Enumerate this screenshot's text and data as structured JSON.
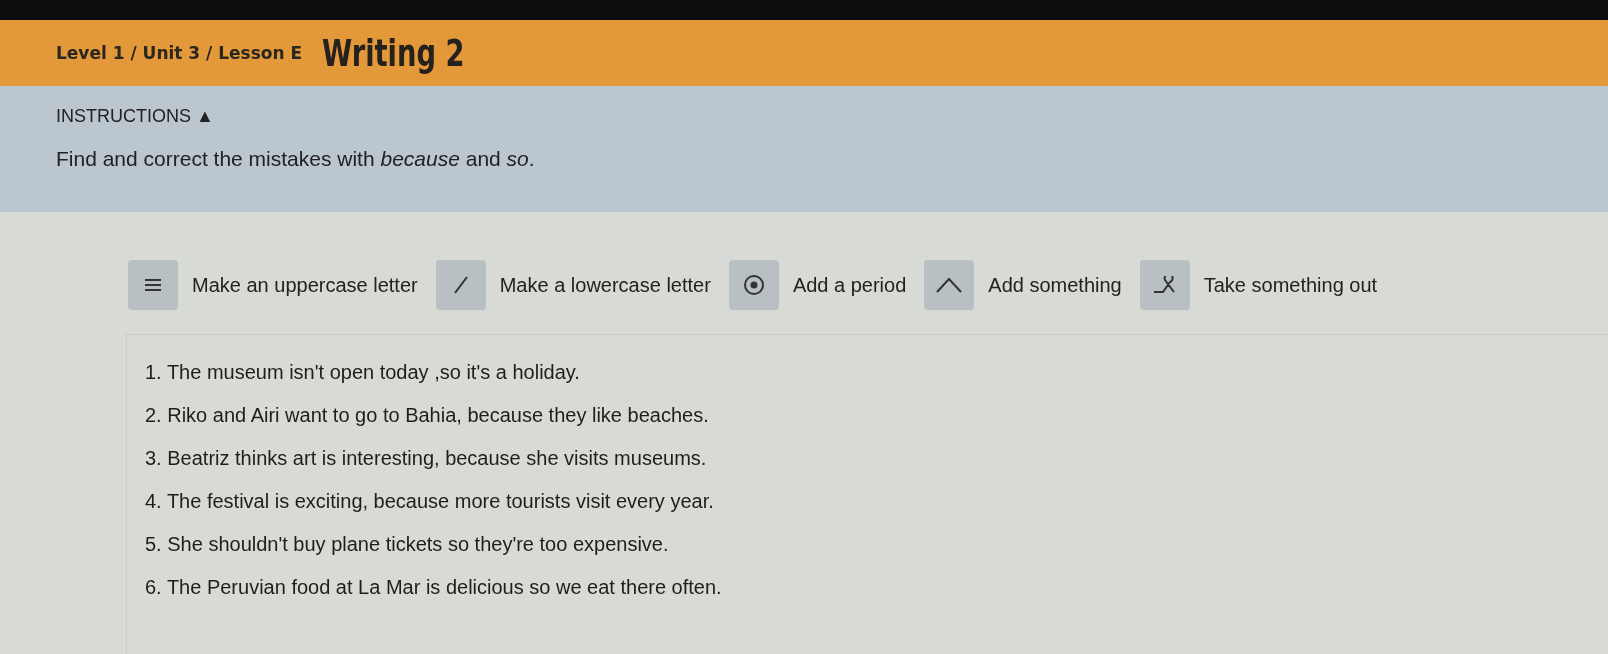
{
  "header": {
    "breadcrumb": "Level 1 / Unit 3 / Lesson E",
    "title": "Writing 2"
  },
  "instructions": {
    "label": "INSTRUCTIONS ▲",
    "text": "Find and correct the mistakes with *because* and *so*."
  },
  "legend": [
    {
      "kind": "uppercase",
      "label": "Make an uppercase letter"
    },
    {
      "kind": "lowercase",
      "label": "Make a lowercase letter"
    },
    {
      "kind": "period",
      "label": "Add a period"
    },
    {
      "kind": "insert",
      "label": "Add something"
    },
    {
      "kind": "delete",
      "label": "Take something out"
    }
  ],
  "sentences": [
    "1. The museum isn't open today ,so it's a holiday.",
    "2. Riko and Airi want to go to Bahia, because they like beaches.",
    "3. Beatriz thinks art is interesting, because she visits museums.",
    "4. The festival is exciting, because more tourists visit every year.",
    "5. She shouldn't buy plane tickets so they're too expensive.",
    "6. The Peruvian food at La Mar is delicious so we eat there often."
  ]
}
